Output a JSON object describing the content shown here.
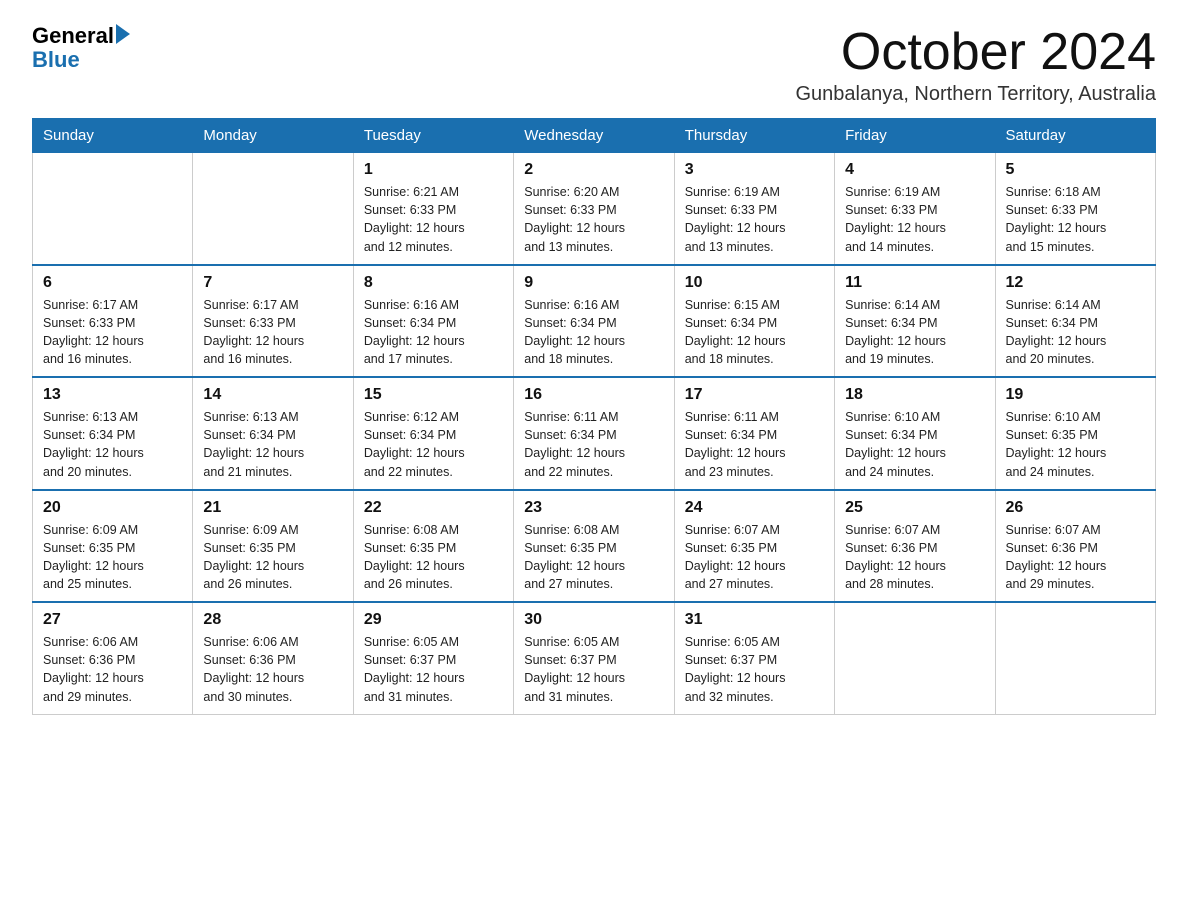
{
  "header": {
    "logo_general": "General",
    "logo_blue": "Blue",
    "month_year": "October 2024",
    "location": "Gunbalanya, Northern Territory, Australia"
  },
  "days_of_week": [
    "Sunday",
    "Monday",
    "Tuesday",
    "Wednesday",
    "Thursday",
    "Friday",
    "Saturday"
  ],
  "weeks": [
    [
      {
        "day": "",
        "info": ""
      },
      {
        "day": "",
        "info": ""
      },
      {
        "day": "1",
        "info": "Sunrise: 6:21 AM\nSunset: 6:33 PM\nDaylight: 12 hours\nand 12 minutes."
      },
      {
        "day": "2",
        "info": "Sunrise: 6:20 AM\nSunset: 6:33 PM\nDaylight: 12 hours\nand 13 minutes."
      },
      {
        "day": "3",
        "info": "Sunrise: 6:19 AM\nSunset: 6:33 PM\nDaylight: 12 hours\nand 13 minutes."
      },
      {
        "day": "4",
        "info": "Sunrise: 6:19 AM\nSunset: 6:33 PM\nDaylight: 12 hours\nand 14 minutes."
      },
      {
        "day": "5",
        "info": "Sunrise: 6:18 AM\nSunset: 6:33 PM\nDaylight: 12 hours\nand 15 minutes."
      }
    ],
    [
      {
        "day": "6",
        "info": "Sunrise: 6:17 AM\nSunset: 6:33 PM\nDaylight: 12 hours\nand 16 minutes."
      },
      {
        "day": "7",
        "info": "Sunrise: 6:17 AM\nSunset: 6:33 PM\nDaylight: 12 hours\nand 16 minutes."
      },
      {
        "day": "8",
        "info": "Sunrise: 6:16 AM\nSunset: 6:34 PM\nDaylight: 12 hours\nand 17 minutes."
      },
      {
        "day": "9",
        "info": "Sunrise: 6:16 AM\nSunset: 6:34 PM\nDaylight: 12 hours\nand 18 minutes."
      },
      {
        "day": "10",
        "info": "Sunrise: 6:15 AM\nSunset: 6:34 PM\nDaylight: 12 hours\nand 18 minutes."
      },
      {
        "day": "11",
        "info": "Sunrise: 6:14 AM\nSunset: 6:34 PM\nDaylight: 12 hours\nand 19 minutes."
      },
      {
        "day": "12",
        "info": "Sunrise: 6:14 AM\nSunset: 6:34 PM\nDaylight: 12 hours\nand 20 minutes."
      }
    ],
    [
      {
        "day": "13",
        "info": "Sunrise: 6:13 AM\nSunset: 6:34 PM\nDaylight: 12 hours\nand 20 minutes."
      },
      {
        "day": "14",
        "info": "Sunrise: 6:13 AM\nSunset: 6:34 PM\nDaylight: 12 hours\nand 21 minutes."
      },
      {
        "day": "15",
        "info": "Sunrise: 6:12 AM\nSunset: 6:34 PM\nDaylight: 12 hours\nand 22 minutes."
      },
      {
        "day": "16",
        "info": "Sunrise: 6:11 AM\nSunset: 6:34 PM\nDaylight: 12 hours\nand 22 minutes."
      },
      {
        "day": "17",
        "info": "Sunrise: 6:11 AM\nSunset: 6:34 PM\nDaylight: 12 hours\nand 23 minutes."
      },
      {
        "day": "18",
        "info": "Sunrise: 6:10 AM\nSunset: 6:34 PM\nDaylight: 12 hours\nand 24 minutes."
      },
      {
        "day": "19",
        "info": "Sunrise: 6:10 AM\nSunset: 6:35 PM\nDaylight: 12 hours\nand 24 minutes."
      }
    ],
    [
      {
        "day": "20",
        "info": "Sunrise: 6:09 AM\nSunset: 6:35 PM\nDaylight: 12 hours\nand 25 minutes."
      },
      {
        "day": "21",
        "info": "Sunrise: 6:09 AM\nSunset: 6:35 PM\nDaylight: 12 hours\nand 26 minutes."
      },
      {
        "day": "22",
        "info": "Sunrise: 6:08 AM\nSunset: 6:35 PM\nDaylight: 12 hours\nand 26 minutes."
      },
      {
        "day": "23",
        "info": "Sunrise: 6:08 AM\nSunset: 6:35 PM\nDaylight: 12 hours\nand 27 minutes."
      },
      {
        "day": "24",
        "info": "Sunrise: 6:07 AM\nSunset: 6:35 PM\nDaylight: 12 hours\nand 27 minutes."
      },
      {
        "day": "25",
        "info": "Sunrise: 6:07 AM\nSunset: 6:36 PM\nDaylight: 12 hours\nand 28 minutes."
      },
      {
        "day": "26",
        "info": "Sunrise: 6:07 AM\nSunset: 6:36 PM\nDaylight: 12 hours\nand 29 minutes."
      }
    ],
    [
      {
        "day": "27",
        "info": "Sunrise: 6:06 AM\nSunset: 6:36 PM\nDaylight: 12 hours\nand 29 minutes."
      },
      {
        "day": "28",
        "info": "Sunrise: 6:06 AM\nSunset: 6:36 PM\nDaylight: 12 hours\nand 30 minutes."
      },
      {
        "day": "29",
        "info": "Sunrise: 6:05 AM\nSunset: 6:37 PM\nDaylight: 12 hours\nand 31 minutes."
      },
      {
        "day": "30",
        "info": "Sunrise: 6:05 AM\nSunset: 6:37 PM\nDaylight: 12 hours\nand 31 minutes."
      },
      {
        "day": "31",
        "info": "Sunrise: 6:05 AM\nSunset: 6:37 PM\nDaylight: 12 hours\nand 32 minutes."
      },
      {
        "day": "",
        "info": ""
      },
      {
        "day": "",
        "info": ""
      }
    ]
  ]
}
